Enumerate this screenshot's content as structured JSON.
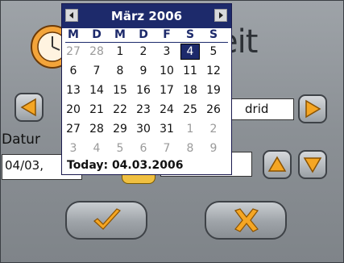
{
  "page": {
    "title_partial": "eit",
    "date_label_partial": "Datur",
    "date_value_partial": "04/03,",
    "city_value_partial": "drid"
  },
  "calendar": {
    "month_title": "März 2006",
    "weekdays": [
      "M",
      "D",
      "M",
      "D",
      "F",
      "S",
      "S"
    ],
    "weeks": [
      [
        {
          "d": "27",
          "o": true
        },
        {
          "d": "28",
          "o": true
        },
        {
          "d": "1"
        },
        {
          "d": "2"
        },
        {
          "d": "3"
        },
        {
          "d": "4",
          "sel": true
        },
        {
          "d": "5"
        }
      ],
      [
        {
          "d": "6"
        },
        {
          "d": "7"
        },
        {
          "d": "8"
        },
        {
          "d": "9"
        },
        {
          "d": "10"
        },
        {
          "d": "11"
        },
        {
          "d": "12"
        }
      ],
      [
        {
          "d": "13"
        },
        {
          "d": "14"
        },
        {
          "d": "15"
        },
        {
          "d": "16"
        },
        {
          "d": "17"
        },
        {
          "d": "18"
        },
        {
          "d": "19"
        }
      ],
      [
        {
          "d": "20"
        },
        {
          "d": "21"
        },
        {
          "d": "22"
        },
        {
          "d": "23"
        },
        {
          "d": "24"
        },
        {
          "d": "25"
        },
        {
          "d": "26"
        }
      ],
      [
        {
          "d": "27"
        },
        {
          "d": "28"
        },
        {
          "d": "29"
        },
        {
          "d": "30"
        },
        {
          "d": "31"
        },
        {
          "d": "1",
          "o": true
        },
        {
          "d": "2",
          "o": true
        }
      ],
      [
        {
          "d": "3",
          "o": true
        },
        {
          "d": "4",
          "o": true
        },
        {
          "d": "5",
          "o": true
        },
        {
          "d": "6",
          "o": true
        },
        {
          "d": "7",
          "o": true
        },
        {
          "d": "8",
          "o": true
        },
        {
          "d": "9",
          "o": true
        }
      ]
    ],
    "today_text": "Today: 04.03.2006"
  },
  "icons": {
    "prev_month": "triangle-left-icon",
    "next_month": "triangle-right-icon",
    "left_arrow": "orange-arrow-left-icon",
    "right_arrow": "orange-arrow-right-icon",
    "up_arrow": "orange-arrow-up-icon",
    "down_arrow": "orange-arrow-down-icon",
    "ok": "checkmark-icon",
    "cancel": "x-icon"
  },
  "colors": {
    "accent_orange": "#f5a623",
    "calendar_header": "#1d2a6b",
    "selected_day": "#1d2a6b"
  }
}
